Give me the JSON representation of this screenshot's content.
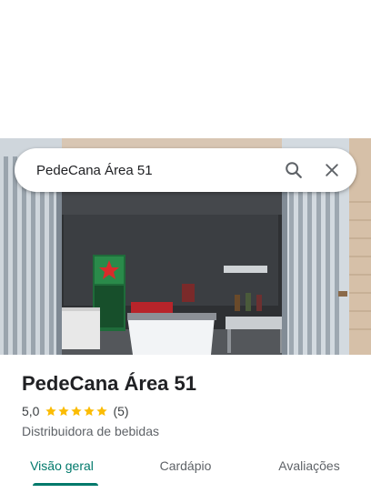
{
  "search": {
    "query": "PedeCana Área 51",
    "search_icon": "search-icon",
    "close_icon": "close-icon"
  },
  "photo": {
    "icon": "storefront-photo"
  },
  "place": {
    "name": "PedeCana Área 51",
    "rating": "5,0",
    "stars": 5,
    "review_count": "(5)",
    "category": "Distribuidora de bebidas"
  },
  "tabs": [
    {
      "label": "Visão geral",
      "active": true
    },
    {
      "label": "Cardápio",
      "active": false
    },
    {
      "label": "Avaliações",
      "active": false
    }
  ],
  "colors": {
    "accent": "#00796b",
    "star": "#fbbc04"
  }
}
